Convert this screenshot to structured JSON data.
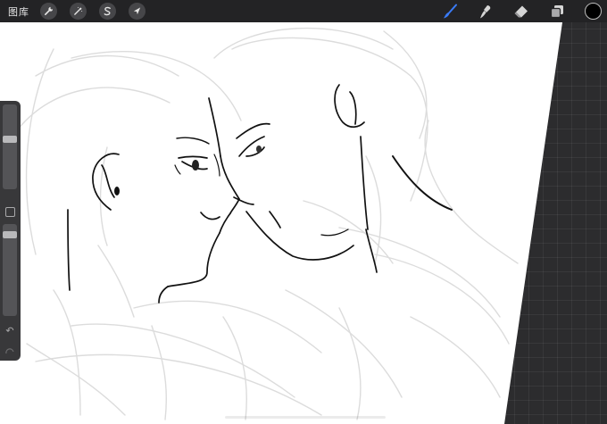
{
  "toolbar": {
    "gallery_label": "图库",
    "left_tools": [
      {
        "name": "actions",
        "icon": "wrench-icon"
      },
      {
        "name": "adjustments",
        "icon": "magic-wand-icon"
      },
      {
        "name": "selection",
        "icon": "selection-s-icon"
      },
      {
        "name": "transform",
        "icon": "arrow-cursor-icon"
      }
    ],
    "right_tools": [
      {
        "name": "brush",
        "icon": "brush-icon",
        "active": true
      },
      {
        "name": "smudge",
        "icon": "smudge-icon"
      },
      {
        "name": "eraser",
        "icon": "eraser-icon"
      },
      {
        "name": "layers",
        "icon": "layers-icon"
      }
    ],
    "current_color": "#000000",
    "active_color": "#3a7bf7"
  },
  "sidebar": {
    "brush_size_level": 0.6,
    "opacity_level": 0.92,
    "undo_glyph": "↶"
  },
  "canvas": {
    "background": "#ffffff",
    "sketch_color": "#d9d9d9",
    "ink_color": "#111111"
  }
}
